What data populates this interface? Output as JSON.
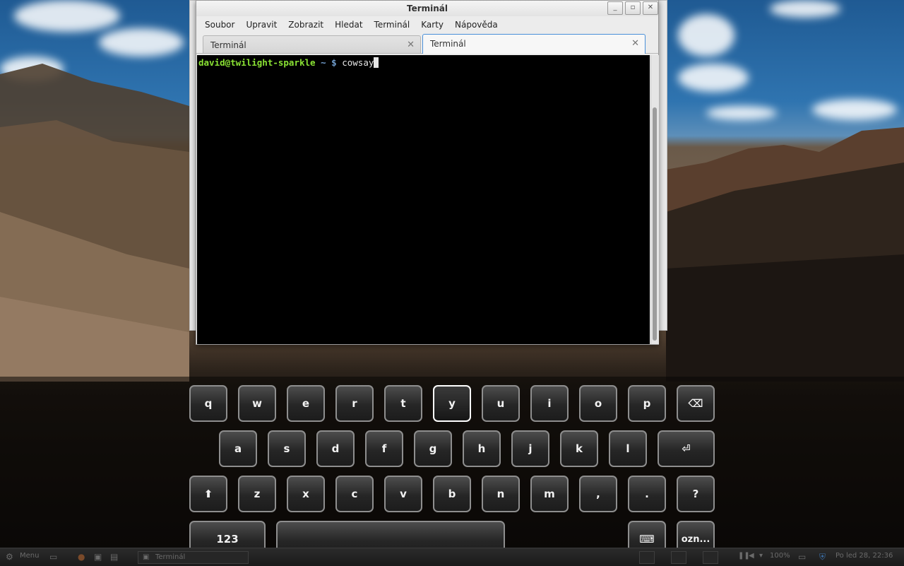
{
  "window": {
    "title": "Terminál",
    "buttons": [
      "_",
      "▫",
      "✕"
    ]
  },
  "menu": [
    "Soubor",
    "Upravit",
    "Zobrazit",
    "Hledat",
    "Terminál",
    "Karty",
    "Nápověda"
  ],
  "tabs": [
    {
      "label": "Terminál",
      "active": false
    },
    {
      "label": "Terminál",
      "active": true
    }
  ],
  "terminal": {
    "user_host": "david@twilight-sparkle",
    "path": "~ $",
    "command": "cowsay"
  },
  "keyboard": {
    "row1": [
      "q",
      "w",
      "e",
      "r",
      "t",
      "y",
      "u",
      "i",
      "o",
      "p",
      "⌫"
    ],
    "row2": [
      "a",
      "s",
      "d",
      "f",
      "g",
      "h",
      "j",
      "k",
      "l",
      "⏎"
    ],
    "row3": [
      "⬆",
      "z",
      "x",
      "c",
      "v",
      "b",
      "n",
      "m",
      ",",
      ".",
      "?"
    ],
    "row4": {
      "numbers": "123",
      "space": "",
      "hide": "⌨",
      "select": "ozn..."
    },
    "active_key": "y"
  },
  "panel": {
    "menu_label": "Menu",
    "task_label": "Terminál",
    "zoom": "100%",
    "clock": "Po led 28, 22:36"
  },
  "colors": {
    "prompt_user": "#8ae234",
    "prompt_dir": "#729fcf",
    "tab_active_border": "#4a90d9"
  }
}
